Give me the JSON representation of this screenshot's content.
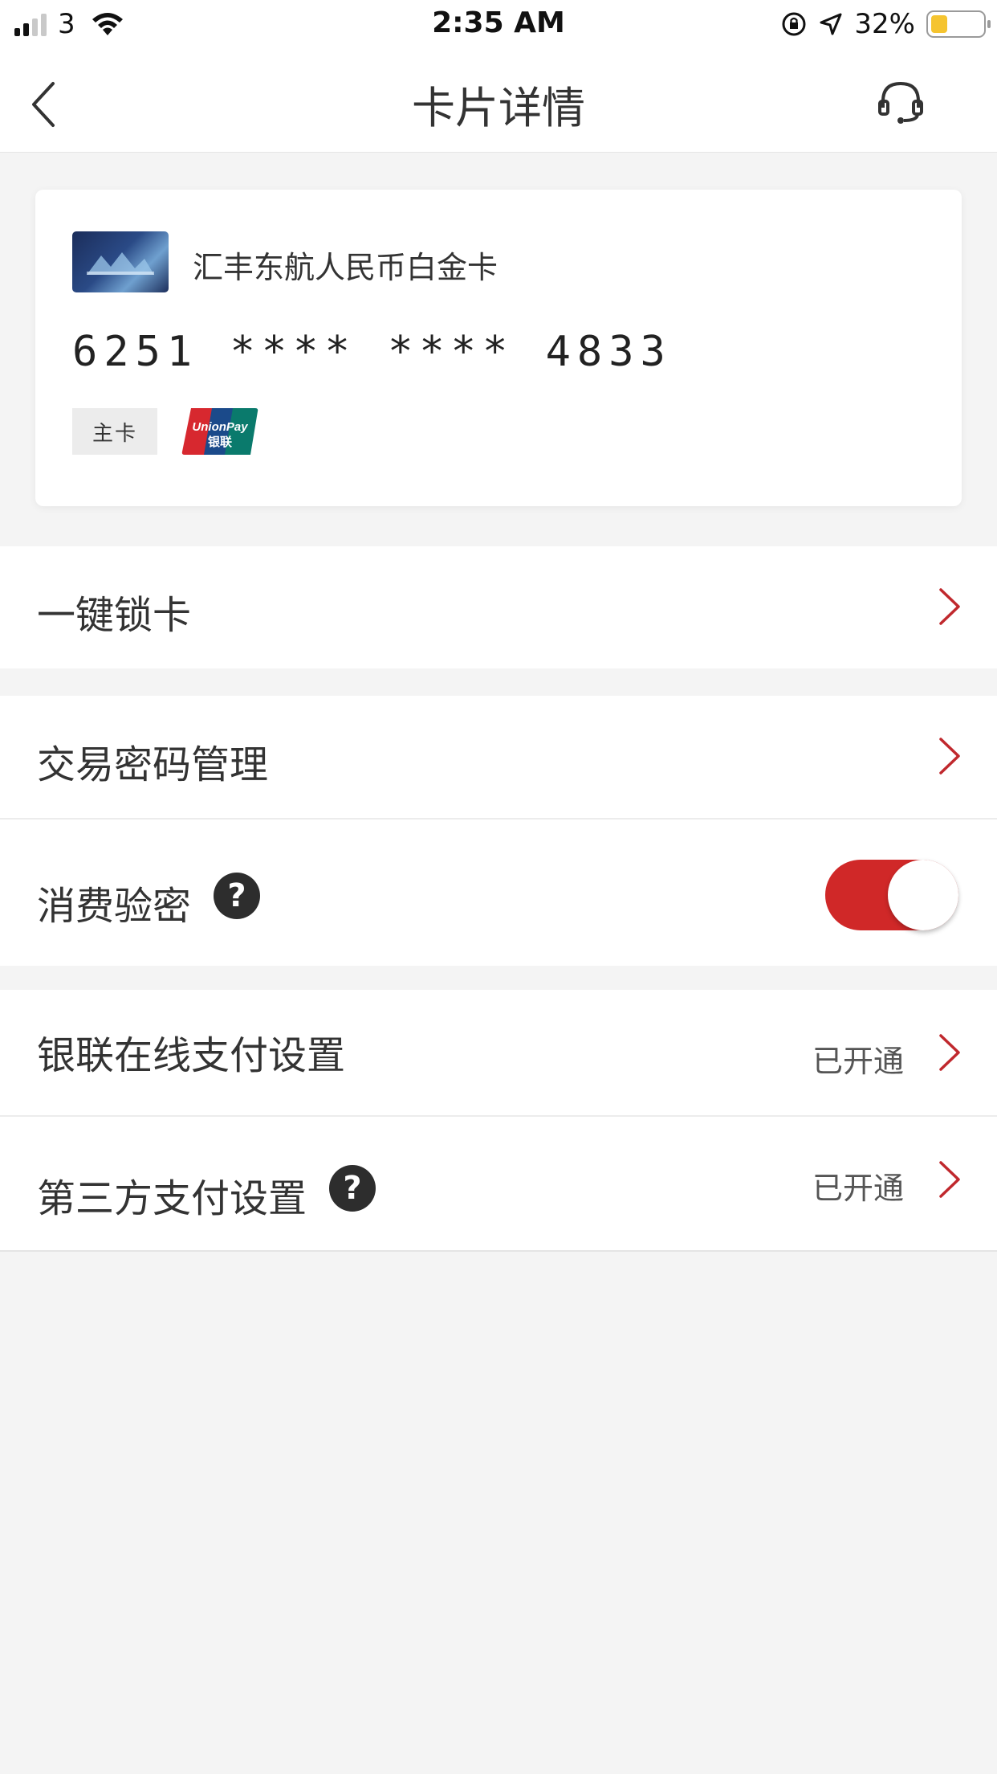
{
  "status_bar": {
    "carrier": "3",
    "time": "2:35 AM",
    "battery_percent": "32%",
    "battery_level": 0.32,
    "signal_bars": 4,
    "signal_bars_active": 2
  },
  "nav": {
    "title": "卡片详情",
    "back_icon": "chevron-left-icon",
    "service_icon": "headset-icon"
  },
  "card": {
    "name": "汇丰东航人民币白金卡",
    "number": "6251 **** **** 4833",
    "type_badge": "主卡",
    "network_logo": "unionpay-logo"
  },
  "rows": [
    {
      "label": "一键锁卡"
    },
    {
      "label": "交易密码管理"
    },
    {
      "label": "消费验密",
      "help": "?",
      "toggle_on": true
    },
    {
      "label": "银联在线支付设置",
      "value": "已开通"
    },
    {
      "label": "第三方支付设置",
      "help": "?",
      "value": "已开通"
    }
  ],
  "colors": {
    "accent": "#d02828",
    "chevron": "#c0282d",
    "background": "#f4f4f4"
  }
}
